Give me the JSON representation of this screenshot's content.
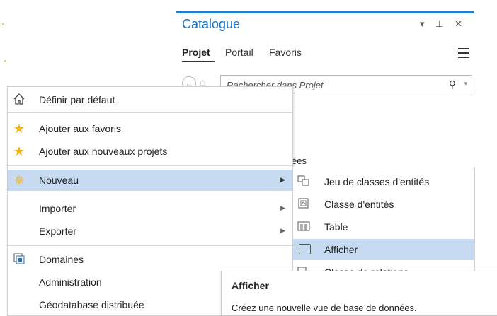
{
  "catalog": {
    "title": "Catalogue",
    "controls": "▾ ⊥ ✕",
    "tabs": [
      {
        "label": "Projet",
        "active": true
      },
      {
        "label": "Portail"
      },
      {
        "label": "Favoris"
      }
    ],
    "search_placeholder": "Rechercher dans Projet",
    "background_fragment": "ées"
  },
  "context_menu": {
    "items": [
      {
        "label": "Définir par défaut",
        "icon": "home-icon"
      },
      {
        "label": "Ajouter aux favoris",
        "icon": "star-icon"
      },
      {
        "label": "Ajouter aux nouveaux projets",
        "icon": "star-icon"
      },
      {
        "label": "Nouveau",
        "icon": "sun-icon",
        "highlighted": true,
        "submenu": true
      },
      {
        "label": "Importer",
        "submenu": true
      },
      {
        "label": "Exporter",
        "submenu": true
      },
      {
        "label": "Domaines",
        "icon": "domains-icon"
      },
      {
        "label": "Administration"
      },
      {
        "label": "Géodatabase distribuée"
      }
    ]
  },
  "submenu": {
    "items": [
      {
        "label": "Jeu de classes d'entités",
        "icon": "feature-dataset-icon"
      },
      {
        "label": "Classe d'entités",
        "icon": "feature-class-icon"
      },
      {
        "label": "Table",
        "icon": "table-icon"
      },
      {
        "label": "Afficher",
        "icon": "view-icon",
        "highlighted": true
      },
      {
        "label": "Classe de relations",
        "icon": "relationship-class-icon"
      }
    ]
  },
  "tooltip": {
    "title": "Afficher",
    "description": "Créez une nouvelle vue de base de données."
  },
  "colors": {
    "accent": "#1a73c7",
    "highlight": "#c6daf1",
    "star": "#f2b416"
  }
}
